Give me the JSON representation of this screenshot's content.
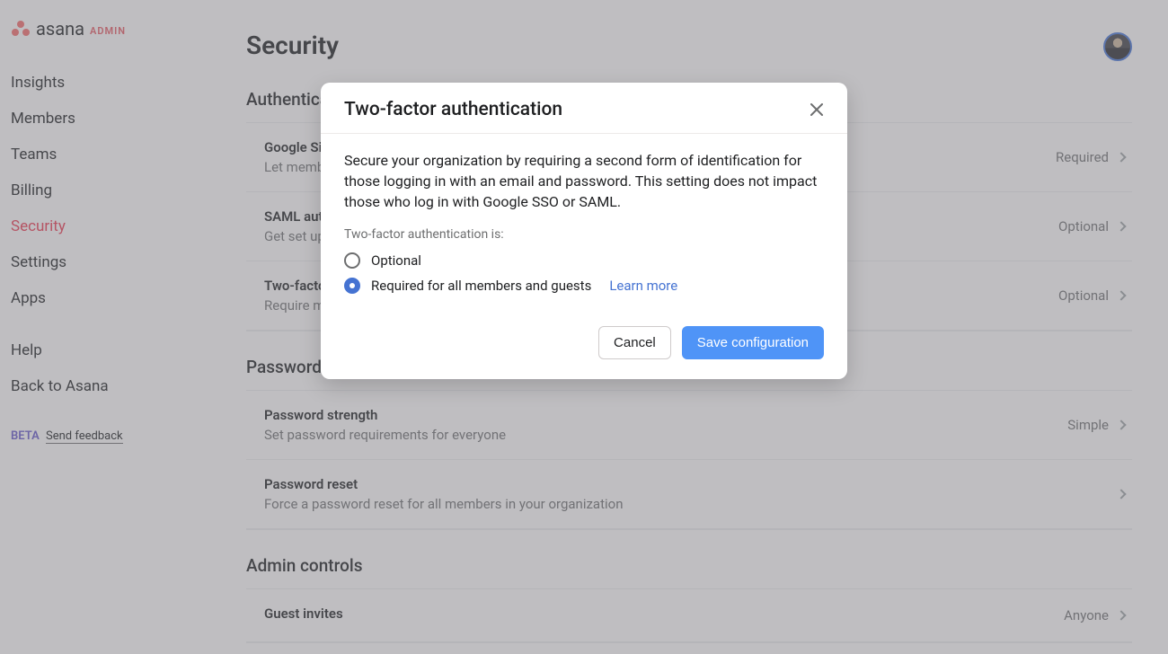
{
  "brand": {
    "name": "asana",
    "tag": "ADMIN"
  },
  "sidebar": {
    "items": [
      {
        "label": "Insights"
      },
      {
        "label": "Members"
      },
      {
        "label": "Teams"
      },
      {
        "label": "Billing"
      },
      {
        "label": "Security",
        "active": true
      },
      {
        "label": "Settings"
      },
      {
        "label": "Apps"
      }
    ],
    "secondary": [
      {
        "label": "Help"
      },
      {
        "label": "Back to Asana"
      }
    ],
    "beta_tag": "BETA",
    "send_feedback": "Send feedback"
  },
  "page": {
    "title": "Security"
  },
  "sections": {
    "authentication": {
      "title": "Authentication",
      "rows": [
        {
          "name": "Google Sign-In",
          "desc": "Let members sign in with Google",
          "value": "Required"
        },
        {
          "name": "SAML authentication",
          "desc": "Get set up with SAML-based single sign-on",
          "value": "Optional"
        },
        {
          "name": "Two-factor authentication",
          "desc": "Require members to use two-factor authentication",
          "value": "Optional"
        }
      ]
    },
    "password": {
      "title": "Password settings",
      "rows": [
        {
          "name": "Password strength",
          "desc": "Set password requirements for everyone",
          "value": "Simple"
        },
        {
          "name": "Password reset",
          "desc": "Force a password reset for all members in your organization",
          "value": ""
        }
      ]
    },
    "admin": {
      "title": "Admin controls",
      "rows": [
        {
          "name": "Guest invites",
          "desc": "",
          "value": "Anyone"
        }
      ]
    }
  },
  "modal": {
    "title": "Two-factor authentication",
    "description": "Secure your organization by requiring a second form of identification for those logging in with an email and password. This setting does not impact those who log in with Google SSO or SAML.",
    "radio_label": "Two-factor authentication is:",
    "options": {
      "optional": "Optional",
      "required": "Required for all members and guests"
    },
    "learn_more": "Learn more",
    "cancel": "Cancel",
    "save": "Save configuration"
  }
}
